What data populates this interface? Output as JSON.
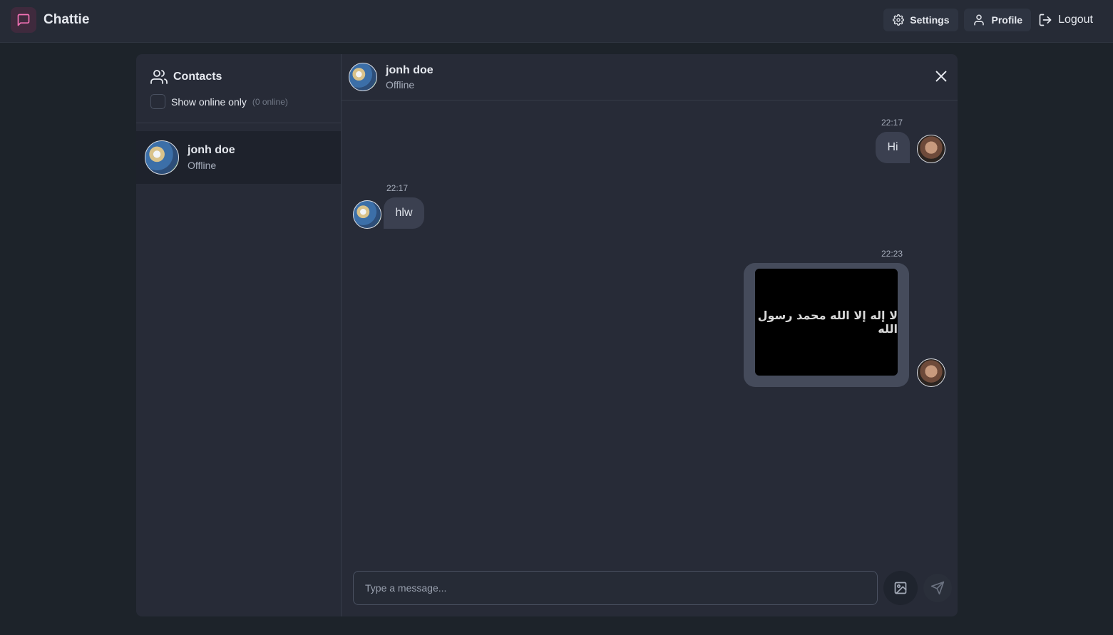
{
  "header": {
    "brand": "Chattie",
    "nav": {
      "settings": "Settings",
      "profile": "Profile",
      "logout": "Logout"
    }
  },
  "sidebar": {
    "title": "Contacts",
    "filter_label": "Show online only",
    "online_count": "(0 online)",
    "contacts": [
      {
        "name": "jonh doe",
        "status": "Offline"
      }
    ]
  },
  "chat": {
    "contact_name": "jonh doe",
    "contact_status": "Offline",
    "messages": [
      {
        "from": "me",
        "time": "22:17",
        "text": "Hi"
      },
      {
        "from": "contact",
        "time": "22:17",
        "text": "hlw"
      },
      {
        "from": "me",
        "time": "22:23",
        "type": "image",
        "image_text": "لا إله إلا الله محمد رسول الله"
      }
    ],
    "input_placeholder": "Type a message..."
  },
  "colors": {
    "background": "#1d232a",
    "panel": "#272b37",
    "bubble": "#3b4050",
    "brand_icon": "#f472b6"
  },
  "icons": {
    "brand": "message-square-icon",
    "settings": "gear-icon",
    "profile": "user-icon",
    "logout": "logout-icon",
    "contacts": "users-icon",
    "close": "close-icon",
    "image": "image-icon",
    "send": "send-icon"
  }
}
